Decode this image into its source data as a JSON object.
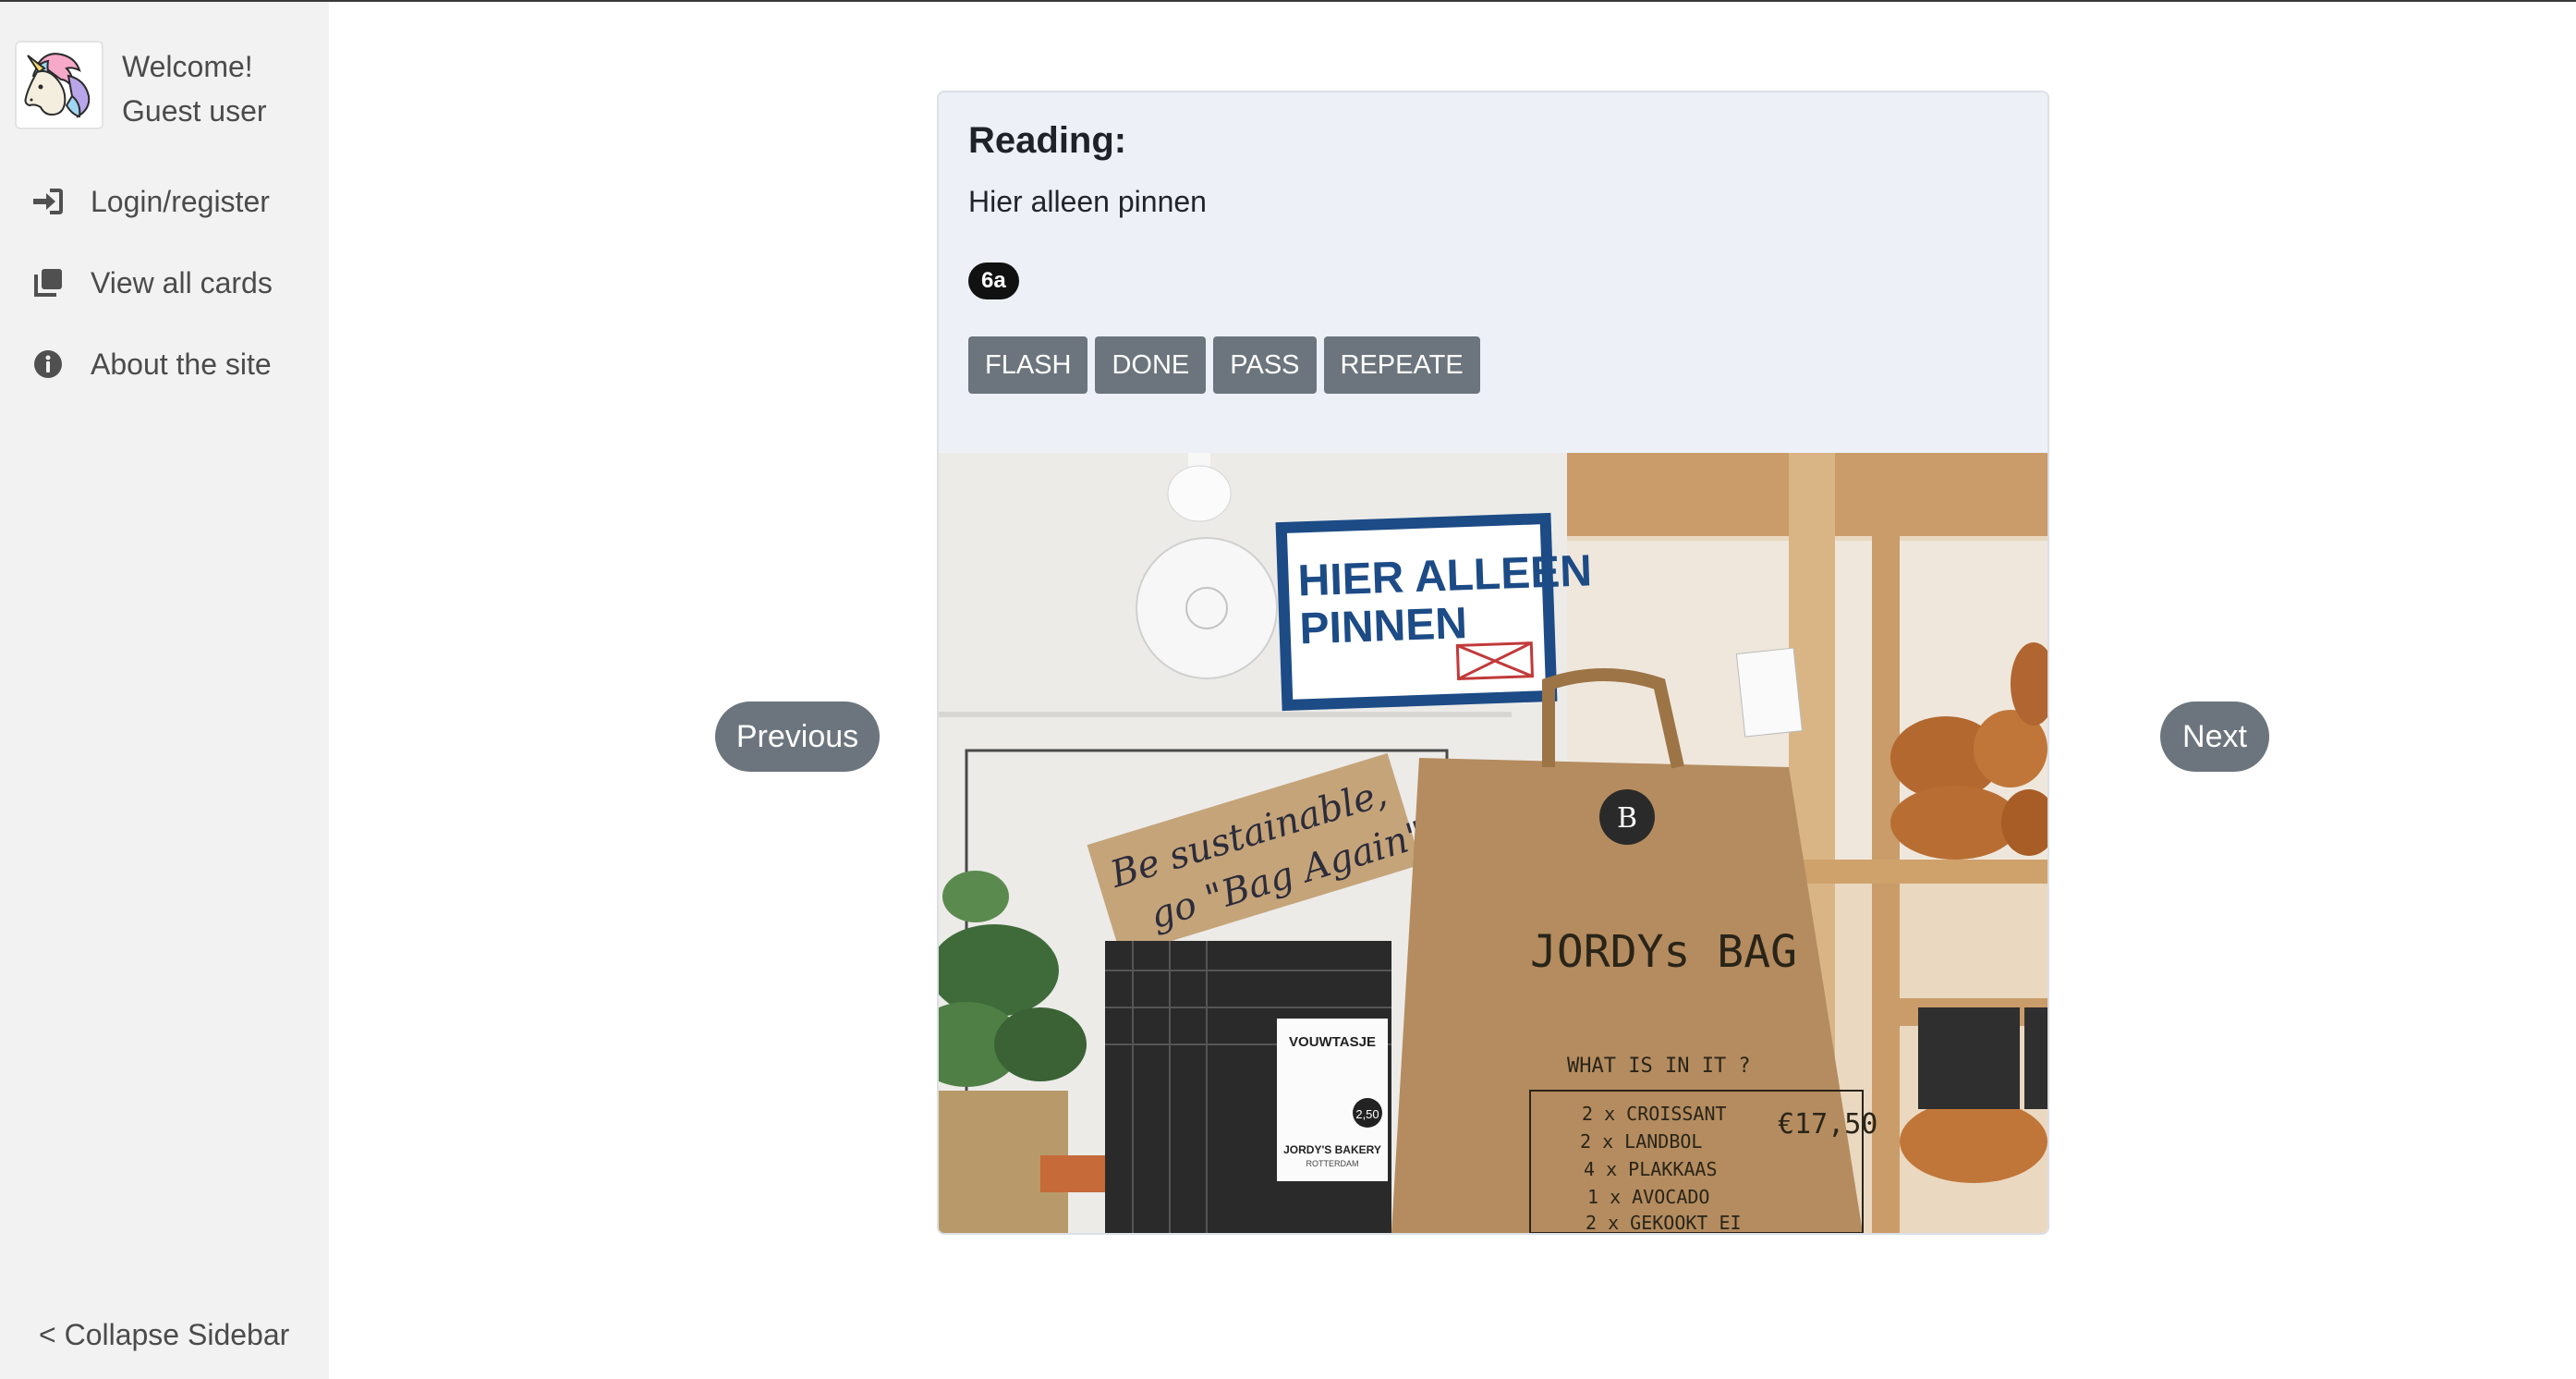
{
  "sidebar": {
    "welcome_line1": "Welcome!",
    "welcome_line2": "Guest user",
    "avatar_icon": "unicorn-icon",
    "items": [
      {
        "label": "Login/register",
        "icon": "login-icon"
      },
      {
        "label": "View all cards",
        "icon": "cards-icon"
      },
      {
        "label": "About the site",
        "icon": "info-icon"
      }
    ],
    "collapse_label": "< Collapse Sidebar"
  },
  "card": {
    "title": "Reading:",
    "text": "Hier alleen pinnen",
    "badge": "6a",
    "buttons": [
      "FLASH",
      "DONE",
      "PASS",
      "REPEATE"
    ]
  },
  "photo": {
    "sign_line1": "HIER ALLEEN",
    "sign_line2": "PINNEN",
    "cardboard_line1": "Be sustainable,",
    "cardboard_line2": "go \"Bag Again\"",
    "bag_title": "JORDYs BAG",
    "bag_subtitle": "WHAT IS IN IT ?",
    "bag_items": [
      "2 x CROISSANT",
      "2 x LANDBOL",
      "4 x PLAKKAAS",
      "1 x AVOCADO",
      "2 x GEKOOKT EI"
    ],
    "bag_price": "€17,50",
    "tag_title": "VOUWTASJE",
    "tag_price": "2,50",
    "tag_brand": "JORDY'S BAKERY",
    "tag_city": "ROTTERDAM"
  },
  "navigation": {
    "previous_label": "Previous",
    "next_label": "Next"
  },
  "colors": {
    "sidebar_bg": "#f2f2f2",
    "card_header_bg": "#edf0f7",
    "button_bg": "#6c757d",
    "badge_bg": "#111111"
  }
}
